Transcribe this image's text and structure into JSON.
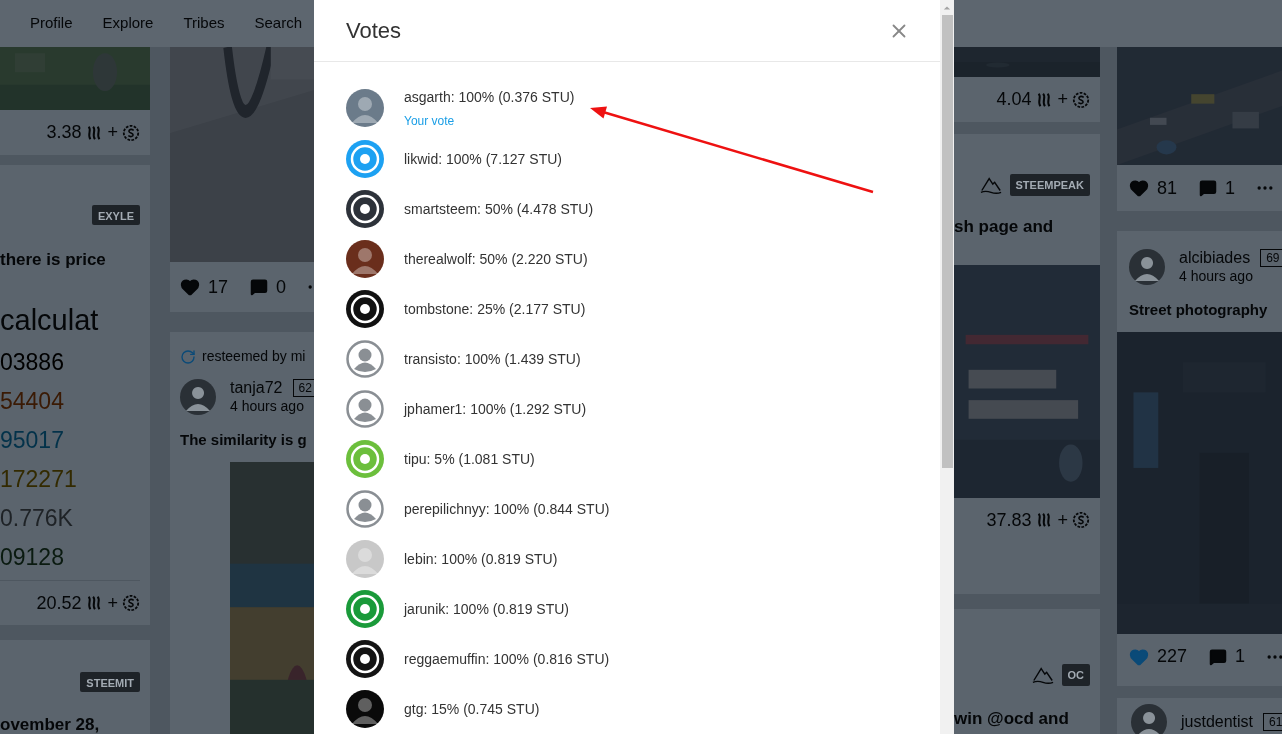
{
  "nav": [
    {
      "label": "Profile"
    },
    {
      "label": "Explore"
    },
    {
      "label": "Tribes"
    },
    {
      "label": "Search"
    }
  ],
  "feed": {
    "column_1": {
      "payout": {
        "amount": "3.38",
        "plus": "+"
      },
      "post": {
        "tag": "EXYLE",
        "title": "there is price",
        "heading": "calculat",
        "lines": [
          {
            "text": "03886",
            "color": "#000000"
          },
          {
            "text": "54404",
            "color": "#3a1a04"
          },
          {
            "text": "95017",
            "color": "#03324a"
          },
          {
            "text": "172271",
            "color": "#332a00"
          },
          {
            "text": "0.776K",
            "color": "#1e2226"
          },
          {
            "text": "09128",
            "color": "#0a1a10"
          }
        ],
        "payout": {
          "amount": "20.52",
          "plus": "+"
        }
      },
      "next_post": {
        "tag": "STEEMIT",
        "title": "ovember 28,"
      }
    },
    "column_2": {
      "actions": {
        "likes": "17",
        "voted": false,
        "comments": "0"
      },
      "post": {
        "resteemed": "resteemed by mi",
        "author": "tanja72",
        "reputation": "62",
        "time": "4 hours ago",
        "title": "The similarity is g"
      }
    },
    "column_3": {
      "payout": {
        "amount": "4.04",
        "plus": "+"
      },
      "post": {
        "tag": "STEEMPEAK",
        "title": "sh page and",
        "payout": {
          "amount": "37.83",
          "plus": "+"
        }
      },
      "next_post": {
        "tag": "OC",
        "title": "win @ocd and"
      }
    },
    "column_4": {
      "actions": {
        "likes": "81",
        "voted": false,
        "comments": "1"
      },
      "post": {
        "author": "alcibiades",
        "reputation": "69",
        "time": "4 hours ago",
        "title": "Street photography",
        "actions": {
          "likes": "227",
          "voted": true,
          "comments": "1"
        }
      },
      "next_post": {
        "author": "justdentist",
        "reputation": "61"
      }
    }
  },
  "dialog": {
    "title": "Votes",
    "votes": [
      {
        "voter": "asgarth: 100% (0.376 STU)",
        "note": "Your vote",
        "color": "#6b7b8a"
      },
      {
        "voter": "likwid: 100% (7.127 STU)",
        "kind": "logo",
        "color": "#1da1f2"
      },
      {
        "voter": "smartsteem: 50% (4.478 STU)",
        "kind": "logo",
        "color": "#2d323a"
      },
      {
        "voter": "therealwolf: 50% (2.220 STU)",
        "color": "#6a2e1c"
      },
      {
        "voter": "tombstone: 25% (2.177 STU)",
        "kind": "logo",
        "color": "#111111"
      },
      {
        "voter": "transisto: 100% (1.439 STU)",
        "kind": "default"
      },
      {
        "voter": "jphamer1: 100% (1.292 STU)",
        "kind": "default"
      },
      {
        "voter": "tipu: 5% (1.081 STU)",
        "kind": "logo",
        "color": "#6cbf3c"
      },
      {
        "voter": "perepilichnyy: 100% (0.844 STU)",
        "kind": "default"
      },
      {
        "voter": "lebin: 100% (0.819 STU)",
        "color": "#c8c8c8"
      },
      {
        "voter": "jarunik: 100% (0.819 STU)",
        "kind": "logo",
        "color": "#1a9a3a"
      },
      {
        "voter": "reggaemuffin: 100% (0.816 STU)",
        "kind": "logo",
        "color": "#141414"
      },
      {
        "voter": "gtg: 15% (0.745 STU)",
        "color": "#0a0a0a"
      }
    ]
  }
}
